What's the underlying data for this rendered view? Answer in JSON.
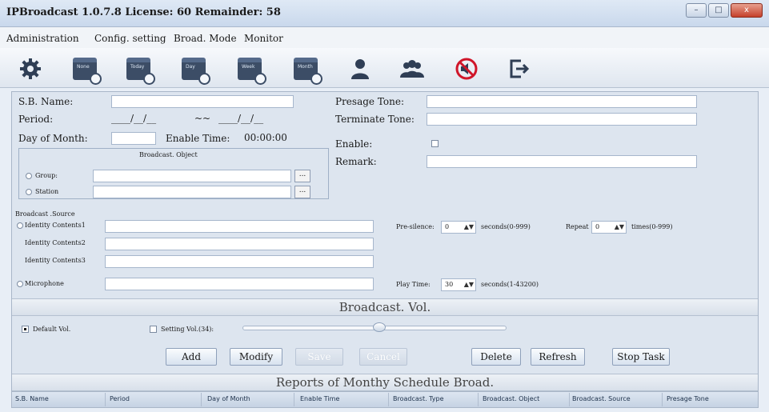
{
  "window": {
    "title": "IPBroadcast 1.0.7.8 License: 60 Remainder: 58",
    "controls": {
      "minimize": "–",
      "maximize": "□",
      "close": "x"
    }
  },
  "menu": [
    "Administration",
    "Config. setting",
    "Broad. Mode",
    "Monitor"
  ],
  "toolbar": {
    "icons": [
      "gear-icon",
      "calendar-none-icon",
      "calendar-today-icon",
      "calendar-day-icon",
      "calendar-week-icon",
      "calendar-month-icon",
      "user-icon",
      "users-icon",
      "mute-icon",
      "exit-icon"
    ],
    "calendar_tags": [
      "None",
      "Today",
      "Day",
      "Week",
      "Month"
    ]
  },
  "form": {
    "sb_name_label": "S.B. Name:",
    "period_label": "Period:",
    "period_from": "____/__/__",
    "period_sep": "~~",
    "period_to": "____/__/__",
    "day_of_month_label": "Day of Month:",
    "enable_time_label": "Enable Time:",
    "enable_time_value": "00:00:00",
    "broadcast_object_title": "Broadcast. Object",
    "group_label": "Group:",
    "station_label": "Station",
    "browse": "...",
    "presage_tone_label": "Presage Tone:",
    "terminate_tone_label": "Terminate Tone:",
    "enable_label": "Enable:",
    "remark_label": "Remark:",
    "source_title": "Broadcast .Source",
    "identity1_label": "Identity Contents1",
    "identity2_label": "Identity Contents2",
    "identity3_label": "Identity Contents3",
    "microphone_label": "Microphone",
    "pre_silence_label": "Pre-silence:",
    "pre_silence_value": "0",
    "pre_silence_unit": "seconds(0-999)",
    "repeat_label": "Repeat",
    "repeat_value": "0",
    "repeat_unit": "times(0-999)",
    "play_time_label": "Play Time:",
    "play_time_value": "30",
    "play_time_unit": "seconds(1-43200)"
  },
  "volume": {
    "title": "Broadcast. Vol.",
    "default_label": "Default Vol.",
    "setting_label": "Setting Vol.(34):",
    "level": 34,
    "max": 100
  },
  "buttons": {
    "add": "Add",
    "modify": "Modify",
    "save": "Save",
    "cancel": "Cancel",
    "delete": "Delete",
    "refresh": "Refresh",
    "stop_task": "Stop Task"
  },
  "report": {
    "title": "Reports of Monthy Schedule Broad.",
    "columns": [
      "S.B. Name",
      "Period",
      "Day of Month",
      "Enable Time",
      "Broadcast. Type",
      "Broadcast. Object",
      "Broadcast. Source",
      "Presage Tone"
    ]
  }
}
